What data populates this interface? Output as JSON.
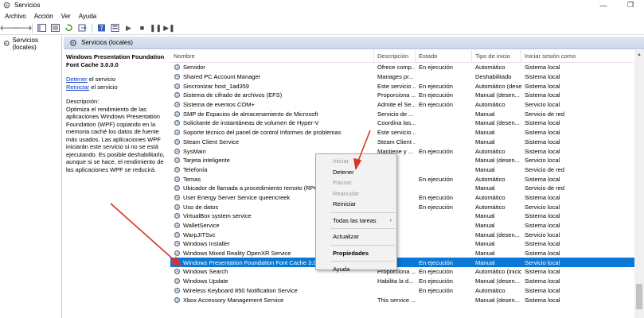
{
  "window": {
    "title": "Servicios"
  },
  "menu": [
    "Archivo",
    "Acción",
    "Ver",
    "Ayuda"
  ],
  "tree": {
    "root_label": "Servicios (locales)"
  },
  "panel": {
    "header_label": "Servicios (locales)"
  },
  "description": {
    "service_title": "Windows Presentation Foundation Font Cache 3.0.0.0",
    "stop_link": "Detener",
    "stop_suffix": " el servicio",
    "restart_link": "Reiniciar",
    "restart_suffix": " el servicio",
    "heading": "Descripción:",
    "body": "Optimiza el rendimiento de las aplicaciones Windows Presentation Foundation (WPF) copiando en la memoria caché los datos de fuente más usados. Las aplicaciones WPF iniciarán este servicio si no se está ejecutando. Es posible deshabilitarlo, aunque si se hace, el rendimiento de las aplicaciones WPF se reducirá."
  },
  "columns": [
    "Nombre",
    "Descripción",
    "Estado",
    "Tipo de inicio",
    "Iniciar sesión como"
  ],
  "rows": [
    [
      "Servidor",
      "Ofrece comp...",
      "En ejecución",
      "Automático",
      "Sistema local"
    ],
    [
      "Shared PC Account Manager",
      "Manages pr...",
      "",
      "Deshabilitado",
      "Sistema local"
    ],
    [
      "Sincronizar host_1ad359",
      "Este servicio ...",
      "En ejecución",
      "Automático (desen...",
      "Sistema local"
    ],
    [
      "Sistema de cifrado de archivos (EFS)",
      "Proporciona ...",
      "En ejecución",
      "Manual (desen...",
      "Sistema local"
    ],
    [
      "Sistema de eventos COM+",
      "Admite el Se...",
      "En ejecución",
      "Automático",
      "Servicio local"
    ],
    [
      "SMP de Espacios de almacenamiento de Microsoft",
      "Servicio de ...",
      "",
      "Manual",
      "Servicio de red"
    ],
    [
      "Solicitante de instantáneas de volumen de Hyper-V",
      "Coordina las...",
      "",
      "Manual (desen...",
      "Sistema local"
    ],
    [
      "Soporte técnico del panel de control Informes de problemas",
      "Este servicio ...",
      "",
      "Manual",
      "Sistema local"
    ],
    [
      "Steam Client Service",
      "Steam Client ...",
      "",
      "Manual",
      "Sistema local"
    ],
    [
      "SysMain",
      "Mantiene y ...",
      "En ejecución",
      "Automático",
      "Sistema local"
    ],
    [
      "Tarjeta inteligente",
      "",
      "",
      "Manual (desen...",
      "Servicio local"
    ],
    [
      "Telefonía",
      "",
      "",
      "Manual",
      "Servicio de red"
    ],
    [
      "Temas",
      "",
      "En ejecución",
      "Automático",
      "Sistema local"
    ],
    [
      "Ubicador de llamada a procedimiento remoto (RPC)",
      "",
      "",
      "Manual",
      "Servicio de red"
    ],
    [
      "User Energy Server Service queencreek",
      "",
      "En ejecución",
      "Automático",
      "Sistema local"
    ],
    [
      "Uso de datos",
      "",
      "En ejecución",
      "Automático",
      "Servicio local"
    ],
    [
      "VirtualBox system service",
      "",
      "",
      "Manual",
      "Sistema local"
    ],
    [
      "WalletService",
      "",
      "",
      "Manual",
      "Sistema local"
    ],
    [
      "WarpJITSvc",
      "...ob",
      "",
      "Manual (desen...",
      "Servicio local"
    ],
    [
      "Windows Installer",
      "...ic...",
      "",
      "Manual",
      "Sistema local"
    ],
    [
      "Windows Mixed Reality OpenXR Service",
      "...X...",
      "",
      "Manual",
      "Sistema local"
    ],
    [
      "Windows Presentation Foundation Font Cache 3.0.0.0",
      "...el r...",
      "En ejecución",
      "Manual",
      "Servicio local"
    ],
    [
      "Windows Search",
      "Proporciona ...",
      "En ejecución",
      "Automático (inicio...",
      "Sistema local"
    ],
    [
      "Windows Update",
      "Habilita la d...",
      "En ejecución",
      "Manual (desen...",
      "Sistema local"
    ],
    [
      "Wireless Keyboard 850 Notification Service",
      "",
      "En ejecución",
      "Automático",
      "Sistema local"
    ],
    [
      "Xbox Accessory Management Service",
      "This service ...",
      "",
      "Manual (desen...",
      "Sistema local"
    ]
  ],
  "selected_row": 21,
  "context_menu": {
    "items": [
      {
        "label": "Iniciar",
        "disabled": true
      },
      {
        "label": "Detener",
        "disabled": false
      },
      {
        "label": "Pausar",
        "disabled": true
      },
      {
        "label": "Reanudar",
        "disabled": true
      },
      {
        "label": "Reiniciar",
        "disabled": false
      },
      {
        "sep": true
      },
      {
        "label": "Todas las tareas",
        "submenu": true
      },
      {
        "sep": true
      },
      {
        "label": "Actualizar"
      },
      {
        "sep": true
      },
      {
        "label": "Propiedades",
        "bold": true
      },
      {
        "sep": true
      },
      {
        "label": "Ayuda"
      }
    ]
  },
  "colors": {
    "selection": "#0a78d6",
    "annotation_arrow": "#d9342b",
    "link": "#0033cc"
  },
  "icons": [
    "services-app-icon",
    "minimize-icon",
    "maximize-icon",
    "back-arrow-icon",
    "forward-arrow-icon",
    "console-tree-icon",
    "list-view-icon",
    "refresh-icon",
    "export-icon",
    "help-icon",
    "properties-icon",
    "play-icon",
    "stop-icon",
    "pause-icon",
    "restart-icon",
    "gear-icon"
  ]
}
